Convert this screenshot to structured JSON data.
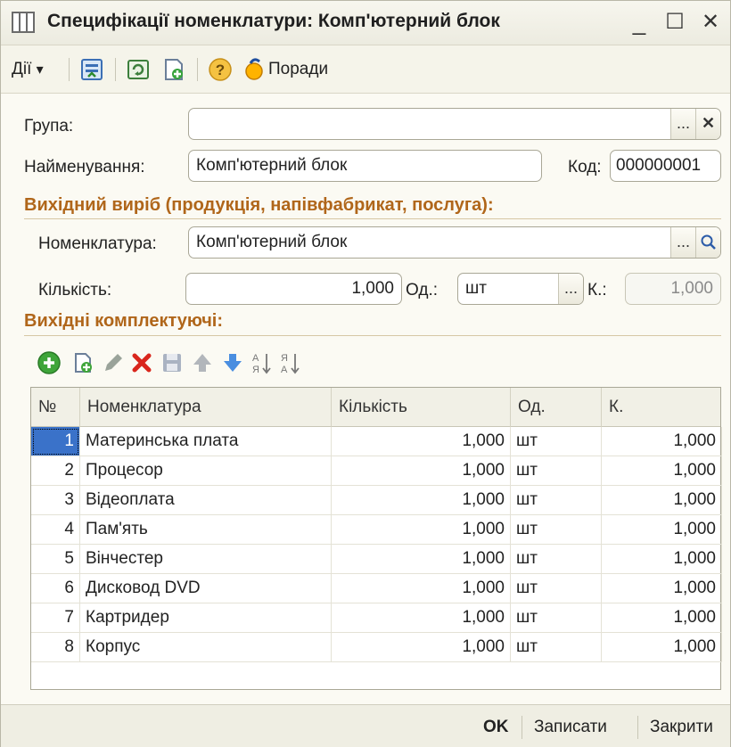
{
  "window": {
    "title": "Специфікації номенклатури: Комп'ютерний блок",
    "minimize": "_",
    "maximize": "☐",
    "close": "✕"
  },
  "toolbar": {
    "actions_label": "Дії",
    "actions_arrow": "▾",
    "tips_label": "Поради",
    "help_glyph": "?"
  },
  "form": {
    "group_label": "Група:",
    "group_value": "",
    "name_label": "Найменування:",
    "name_value": "Комп'ютерний блок",
    "code_label": "Код:",
    "code_value": "000000001",
    "output_section": "Вихідний виріб (продукція, напівфабрикат, послуга):",
    "nomenclature_label": "Номенклатура:",
    "nomenclature_value": "Комп'ютерний блок",
    "quantity_label": "Кількість:",
    "quantity_value": "1,000",
    "unit_label": "Од.:",
    "unit_value": "шт",
    "coef_label": "К.:",
    "coef_value": "1,000",
    "components_section": "Вихідні комплектуючі:",
    "select_glyph": "...",
    "clear_glyph": "✕"
  },
  "table": {
    "columns": [
      "№",
      "Номенклатура",
      "Кількість",
      "Од.",
      "К."
    ],
    "rows": [
      {
        "n": "1",
        "name": "Материнська плата",
        "qty": "1,000",
        "unit": "шт",
        "k": "1,000"
      },
      {
        "n": "2",
        "name": "Процесор",
        "qty": "1,000",
        "unit": "шт",
        "k": "1,000"
      },
      {
        "n": "3",
        "name": "Відеоплата",
        "qty": "1,000",
        "unit": "шт",
        "k": "1,000"
      },
      {
        "n": "4",
        "name": "Пам'ять",
        "qty": "1,000",
        "unit": "шт",
        "k": "1,000"
      },
      {
        "n": "5",
        "name": "Вінчестер",
        "qty": "1,000",
        "unit": "шт",
        "k": "1,000"
      },
      {
        "n": "6",
        "name": "Дисковод DVD",
        "qty": "1,000",
        "unit": "шт",
        "k": "1,000"
      },
      {
        "n": "7",
        "name": "Картридер",
        "qty": "1,000",
        "unit": "шт",
        "k": "1,000"
      },
      {
        "n": "8",
        "name": "Корпус",
        "qty": "1,000",
        "unit": "шт",
        "k": "1,000"
      }
    ]
  },
  "footer": {
    "ok_label": "OK",
    "save_label": "Записати",
    "close_label": "Закрити"
  },
  "icons": {
    "add": "add-circle-icon",
    "copy": "copy-icon",
    "edit": "pencil-icon",
    "delete": "delete-x-icon",
    "save_row": "save-icon",
    "move_up": "arrow-up-icon",
    "move_down": "arrow-down-icon",
    "sort_asc": "sort-ascending-icon",
    "sort_desc": "sort-descending-icon"
  },
  "colors": {
    "section_title": "#b0661a",
    "selection": "#3a72c9",
    "add_green": "#3fa53a",
    "delete_red": "#d9261c",
    "arrow_blue": "#4a8ee0"
  }
}
